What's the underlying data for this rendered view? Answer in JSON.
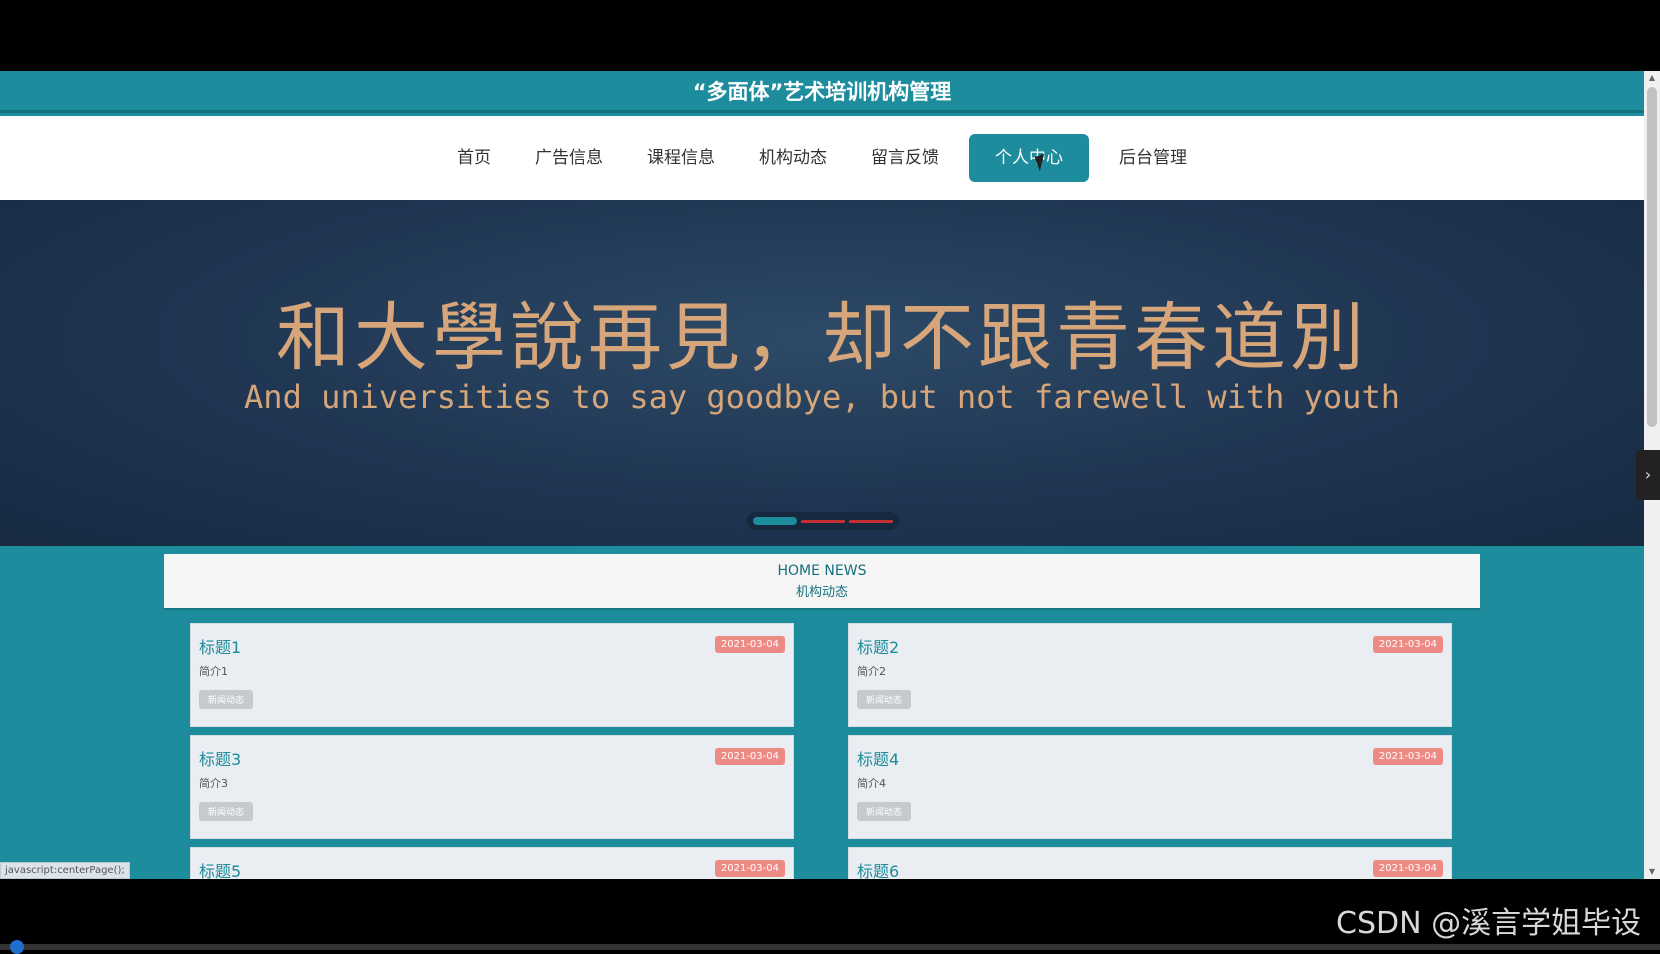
{
  "header": {
    "title": "“多面体”艺术培训机构管理"
  },
  "nav": {
    "items": [
      {
        "label": "首页",
        "active": false
      },
      {
        "label": "广告信息",
        "active": false
      },
      {
        "label": "课程信息",
        "active": false
      },
      {
        "label": "机构动态",
        "active": false
      },
      {
        "label": "留言反馈",
        "active": false
      },
      {
        "label": "个人中心",
        "active": true
      },
      {
        "label": "后台管理",
        "active": false
      }
    ]
  },
  "banner": {
    "headline_cn": "和大學說再見，却不跟青春道別",
    "headline_en": "And universities to say goodbye, but not farewell with youth",
    "slides": 3,
    "active_slide": 1,
    "next_icon": "chevron-right-icon"
  },
  "news": {
    "heading_en": "HOME NEWS",
    "heading_cn": "机构动态",
    "cards": [
      {
        "title": "标题1",
        "date": "2021-03-04",
        "desc": "简介1",
        "tag": "新闻动态"
      },
      {
        "title": "标题2",
        "date": "2021-03-04",
        "desc": "简介2",
        "tag": "新闻动态"
      },
      {
        "title": "标题3",
        "date": "2021-03-04",
        "desc": "简介3",
        "tag": "新闻动态"
      },
      {
        "title": "标题4",
        "date": "2021-03-04",
        "desc": "简介4",
        "tag": "新闻动态"
      },
      {
        "title": "标题5",
        "date": "2021-03-04",
        "desc": "",
        "tag": ""
      },
      {
        "title": "标题6",
        "date": "2021-03-04",
        "desc": "",
        "tag": ""
      }
    ]
  },
  "status_bar": {
    "text": "javascript:centerPage();"
  },
  "watermark": {
    "text": "CSDN @溪言学姐毕设"
  },
  "colors": {
    "primary": "#1d8c9c",
    "date_badge": "#ee8a84",
    "banner_text": "#d6a67a"
  }
}
